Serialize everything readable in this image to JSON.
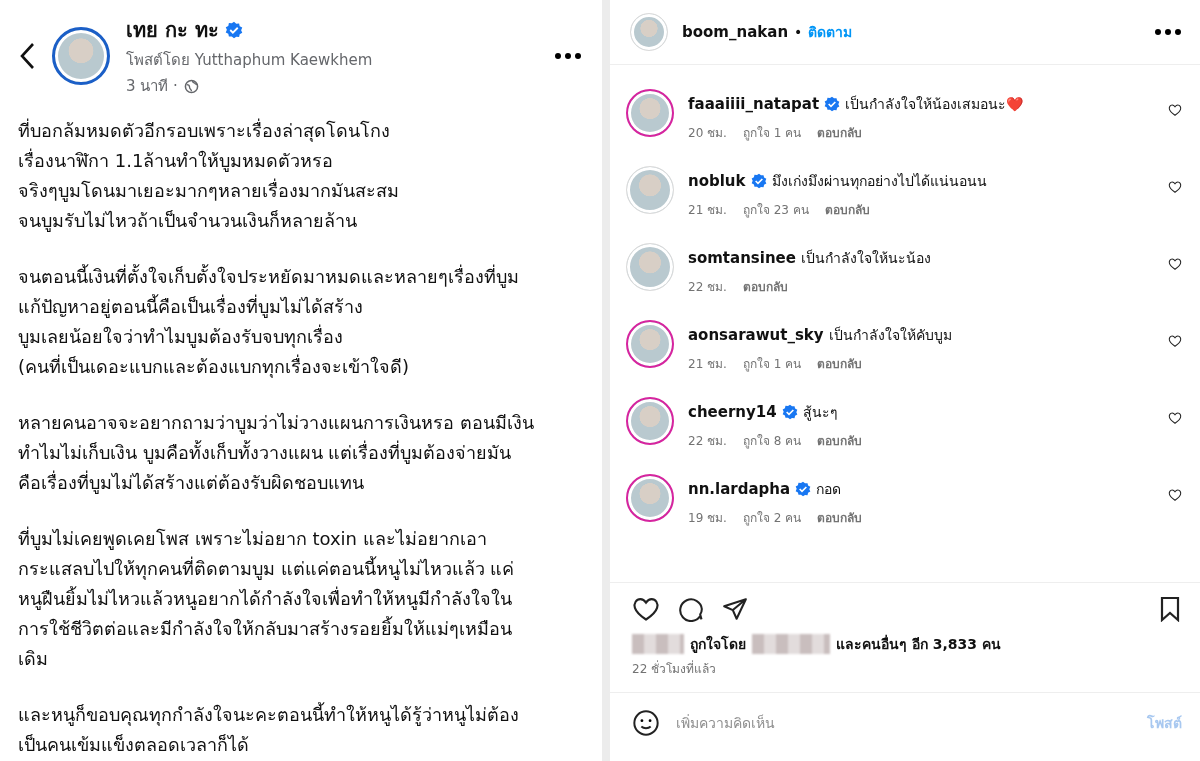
{
  "post": {
    "author": "เทย กะ ทะ",
    "verified": true,
    "posted_by": "โพสต์โดย Yutthaphum Kaewkhem",
    "time": "3 นาที ·",
    "paragraphs": [
      [
        "ที่บอกล้มหมดตัวอีกรอบเพราะเรื่องล่าสุดโดนโกง",
        "เรื่องนาฬิกา 1.1ล้านทำให้บูมหมดตัวหรอ",
        "จริงๆบูมโดนมาเยอะมากๆหลายเรื่องมากมันสะสม",
        "จนบูมรับไม่ไหวถ้าเป็นจำนวนเงินก็หลายล้าน"
      ],
      [
        "จนตอนนี้เงินที่ตั้งใจเก็บตั้งใจประหยัดมาหมดและหลายๆเรื่องที่บูม",
        "แก้ปัญหาอยู่ตอนนี้คือเป็นเรื่องที่บูมไม่ได้สร้าง",
        "บูมเลยน้อยใจว่าทำไมบูมต้องรับจบทุกเรื่อง",
        "(คนที่เป็นเดอะแบกและต้องแบกทุกเรื่องจะเข้าใจดี)"
      ],
      [
        "หลายคนอาจจะอยากถามว่าบูมว่าไม่วางแผนการเงินหรอ ตอนมีเงิน",
        "ทำไมไม่เก็บเงิน บูมคือทั้งเก็บทั้งวางแผน แต่เรื่องที่บูมต้องจ่ายมัน",
        "คือเรื่องที่บูมไม่ได้สร้างแต่ต้องรับผิดชอบแทน"
      ],
      [
        "ที่บูมไม่เคยพูดเคยโพส เพราะไม่อยาก  toxin และไม่อยากเอา",
        "กระแสลบไปให้ทุกคนที่ติดตามบูม แต่แค่ตอนนี้หนูไม่ไหวแล้ว แค่",
        "หนูฝืนยิ้มไม่ไหวแล้วหนูอยากได้กำลังใจเพื่อทำให้หนูมีกำลังใจใน",
        "การใช้ชีวิตต่อและมีกำลังใจให้กลับมาสร้างรอยยิ้มให้แม่ๆเหมือน",
        "เดิม"
      ],
      [
        "และหนูก็ขอบคุณทุกกำลังใจนะคะตอนนี้ทำให้หนูได้รู้ว่าหนูไม่ต้อง",
        "เป็นคนเข้มแข็งตลอดเวลาก็ได้"
      ]
    ]
  },
  "instagram": {
    "username": "boom_nakan",
    "follow": "ติดตาม",
    "separator": "•",
    "comments": [
      {
        "user": "faaaiiii_natapat",
        "verified": true,
        "text": "เป็นกำลังใจให้น้องเสมอนะ❤️",
        "story_ring": true,
        "time": "20 ชม.",
        "likes": "ถูกใจ 1 คน",
        "reply": "ตอบกลับ"
      },
      {
        "user": "nobluk",
        "verified": true,
        "text": "มึงเก่งมึงผ่านทุกอย่างไปได้แน่นอนน",
        "story_ring": false,
        "time": "21 ชม.",
        "likes": "ถูกใจ 23 คน",
        "reply": "ตอบกลับ"
      },
      {
        "user": "somtansinee",
        "verified": false,
        "text": "เป็นกำลังใจให้นะน้อง",
        "story_ring": false,
        "time": "22 ชม.",
        "reply": "ตอบกลับ"
      },
      {
        "user": "aonsarawut_sky",
        "verified": false,
        "text": "เป็นกำลังใจให้คับบูม",
        "story_ring": true,
        "time": "21 ชม.",
        "likes": "ถูกใจ 1 คน",
        "reply": "ตอบกลับ"
      },
      {
        "user": "cheerny14",
        "verified": true,
        "text": "สู้นะๆ",
        "story_ring": true,
        "time": "22 ชม.",
        "likes": "ถูกใจ 8 คน",
        "reply": "ตอบกลับ"
      },
      {
        "user": "nn.lardapha",
        "verified": true,
        "text": "กอด",
        "story_ring": true,
        "time": "19 ชม.",
        "likes": "ถูกใจ 2 คน",
        "reply": "ตอบกลับ"
      }
    ],
    "liked_by": "ถูกใจโดย",
    "liked_others": "และคนอื่นๆ อีก 3,833 คน",
    "posted_ago": "22 ชั่วโมงที่แล้ว",
    "comment_placeholder": "เพิ่มความคิดเห็น",
    "post_button": "โพสต์"
  }
}
